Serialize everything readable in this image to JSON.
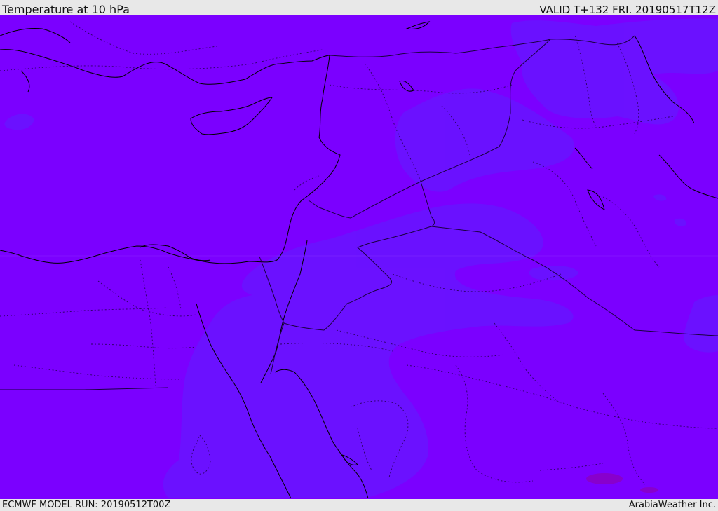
{
  "header": {
    "title": "Temperature at 10 hPa",
    "valid": "VALID T+132 FRI. 20190517T12Z"
  },
  "footer": {
    "model_run": "ECMWF MODEL RUN: 20190512T00Z",
    "credit": "ArabiaWeather Inc."
  },
  "map": {
    "colors": {
      "base_fill": "#7b00ff",
      "warmer_band": "#6a10ff",
      "cold_spot": "#8a00d8",
      "coastline": "#000000",
      "border": "#1a0040"
    },
    "region": "Middle East / Eastern Mediterranean"
  }
}
